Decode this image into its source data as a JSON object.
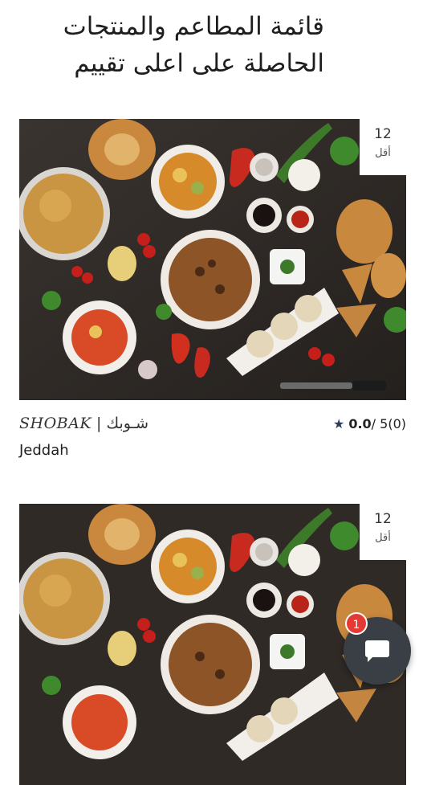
{
  "page": {
    "title": "قائمة المطاعم والمنتجات الحاصلة على اعلى تقييم"
  },
  "restaurants": [
    {
      "name_latin": "SHOBAK",
      "separator": "|",
      "name_arabic": "شـوبك",
      "city": "Jeddah",
      "rating_score": "0.0",
      "rating_out_of": "/ 5",
      "rating_count": "(0)",
      "badge_number": "12",
      "badge_label": "أقل",
      "image": "food-spread-photo"
    },
    {
      "badge_number": "12",
      "badge_label": "أقل",
      "image": "food-spread-photo"
    }
  ],
  "chat": {
    "icon": "chat-bubble-icon",
    "unread_count": "1"
  },
  "colors": {
    "star": "#2f3d58",
    "chat_button": "#3a3e45",
    "badge_red": "#e53935"
  }
}
